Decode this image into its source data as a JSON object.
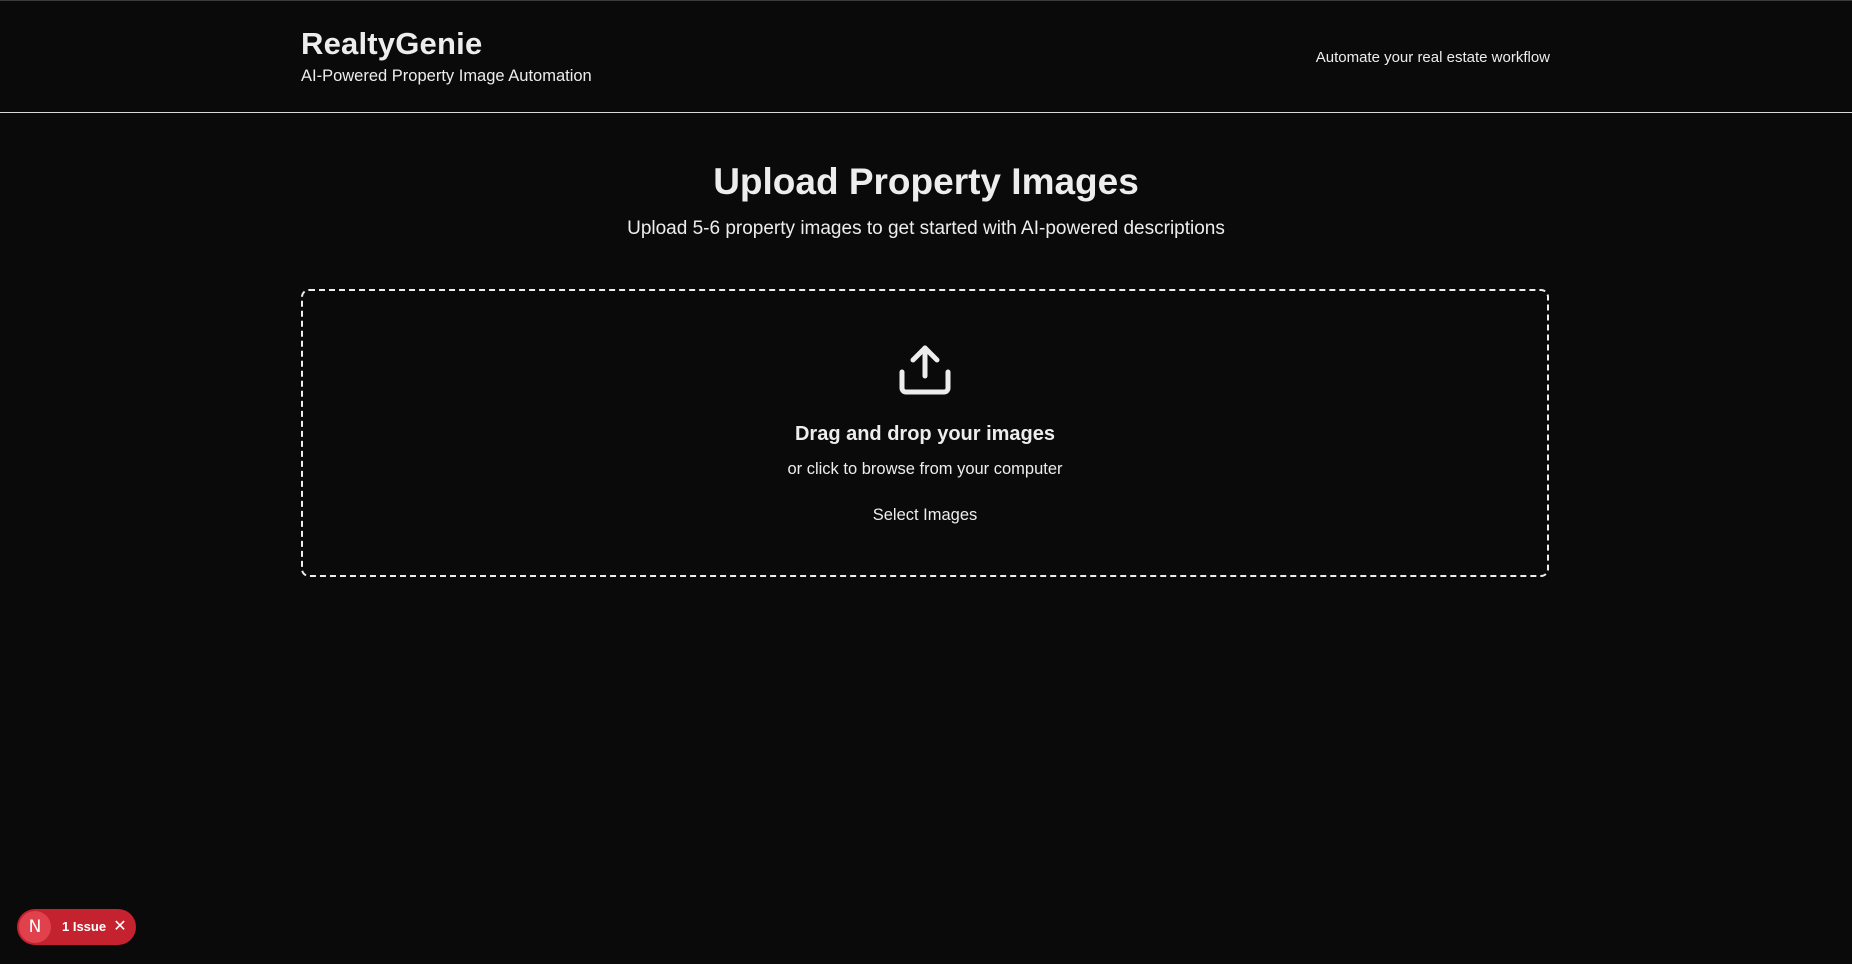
{
  "header": {
    "app_title": "RealtyGenie",
    "app_subtitle": "AI-Powered Property Image Automation",
    "tagline": "Automate your real estate workflow"
  },
  "main": {
    "title": "Upload Property Images",
    "subtitle": "Upload 5-6 property images to get started with AI-powered descriptions",
    "dropzone": {
      "icon": "upload-icon",
      "title": "Drag and drop your images",
      "subtitle": "or click to browse from your computer",
      "button_label": "Select Images"
    }
  },
  "dev_indicator": {
    "logo_letter": "N",
    "issues_label": "1 Issue",
    "close_icon": "close-icon",
    "color": "#c5222f"
  },
  "colors": {
    "background": "#0a0a0a",
    "foreground": "#ededed"
  }
}
